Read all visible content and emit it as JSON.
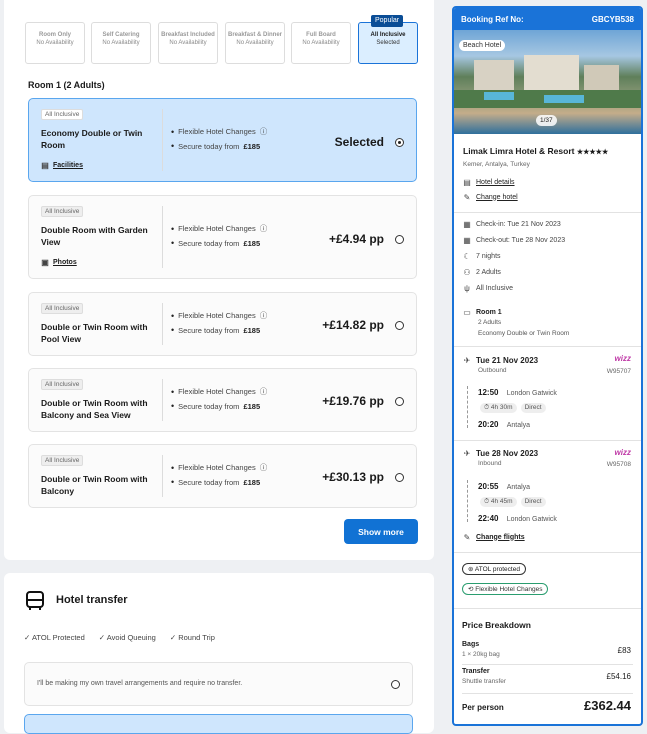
{
  "boards": [
    {
      "name": "Room Only",
      "status": "No Availability"
    },
    {
      "name": "Self Catering",
      "status": "No Availability"
    },
    {
      "name": "Breakfast Included",
      "status": "No Availability"
    },
    {
      "name": "Breakfast & Dinner",
      "status": "No Availability"
    },
    {
      "name": "Full Board",
      "status": "No Availability"
    },
    {
      "name": "All Inclusive",
      "status": "Selected",
      "badge": "Popular"
    }
  ],
  "room_heading": "Room 1 (2 Adults)",
  "rooms": [
    {
      "tag": "All Inclusive",
      "name": "Economy Double or Twin Room",
      "feature1": "Flexible Hotel Changes",
      "feature2_pre": "Secure today from ",
      "feature2_amt": "£185",
      "price": "Selected",
      "link": "Facilities"
    },
    {
      "tag": "All Inclusive",
      "name": "Double Room with Garden View",
      "feature1": "Flexible Hotel Changes",
      "feature2_pre": "Secure today from ",
      "feature2_amt": "£185",
      "price": "+£4.94 pp",
      "link": "Photos"
    },
    {
      "tag": "All Inclusive",
      "name": "Double or Twin Room with Pool View",
      "feature1": "Flexible Hotel Changes",
      "feature2_pre": "Secure today from ",
      "feature2_amt": "£185",
      "price": "+£14.82 pp"
    },
    {
      "tag": "All Inclusive",
      "name": "Double or Twin Room with Balcony and Sea View",
      "feature1": "Flexible Hotel Changes",
      "feature2_pre": "Secure today from ",
      "feature2_amt": "£185",
      "price": "+£19.76 pp"
    },
    {
      "tag": "All Inclusive",
      "name": "Double or Twin Room with Balcony",
      "feature1": "Flexible Hotel Changes",
      "feature2_pre": "Secure today from ",
      "feature2_amt": "£185",
      "price": "+£30.13 pp"
    }
  ],
  "show_more": "Show more",
  "transfer": {
    "title": "Hotel transfer",
    "benefits": [
      "ATOL Protected",
      "Avoid Queuing",
      "Round Trip"
    ],
    "option_none": "I'll be making my own travel arrangements and require no transfer."
  },
  "summary": {
    "ref_label": "Booking Ref No:",
    "ref": "GBCYB538",
    "image_tag": "Beach Hotel",
    "image_count": "1/37",
    "hotel_name": "Limak Limra Hotel & Resort",
    "stars": "★★★★★",
    "location": "Kemer, Antalya, Turkey",
    "hotel_details": "Hotel details",
    "change_hotel": "Change hotel",
    "checkin": "Check-in: Tue 21 Nov 2023",
    "checkout": "Check-out: Tue 28 Nov 2023",
    "nights": "7 nights",
    "adults": "2 Adults",
    "board": "All Inclusive",
    "room_title": "Room 1",
    "room_adults": "2 Adults",
    "room_type": "Economy Double or Twin Room",
    "outbound": {
      "date": "Tue 21 Nov 2023",
      "label": "Outbound",
      "flight": "W95707",
      "dep_time": "12:50",
      "dep": "London Gatwick",
      "duration": "4h 30m",
      "stops": "Direct",
      "arr_time": "20:20",
      "arr": "Antalya"
    },
    "inbound": {
      "date": "Tue 28 Nov 2023",
      "label": "Inbound",
      "flight": "W95708",
      "dep_time": "20:55",
      "dep": "Antalya",
      "duration": "4h 45m",
      "stops": "Direct",
      "arr_time": "22:40",
      "arr": "London Gatwick"
    },
    "airline": "wizz",
    "change_flights": "Change flights",
    "atol": "ATOL protected",
    "flex": "Flexible Hotel Changes",
    "price_title": "Price Breakdown",
    "bags_label": "Bags",
    "bags_detail": "1 × 20kg bag",
    "bags_price": "£83",
    "transfer_label": "Transfer",
    "transfer_detail": "Shuttle transfer",
    "transfer_price": "£54.16",
    "pp_label": "Per person",
    "pp_price": "£362.44"
  },
  "colors": {
    "primary": "#1172d4",
    "selected_bg": "#cfe6fd",
    "navy": "#0a4d96"
  }
}
